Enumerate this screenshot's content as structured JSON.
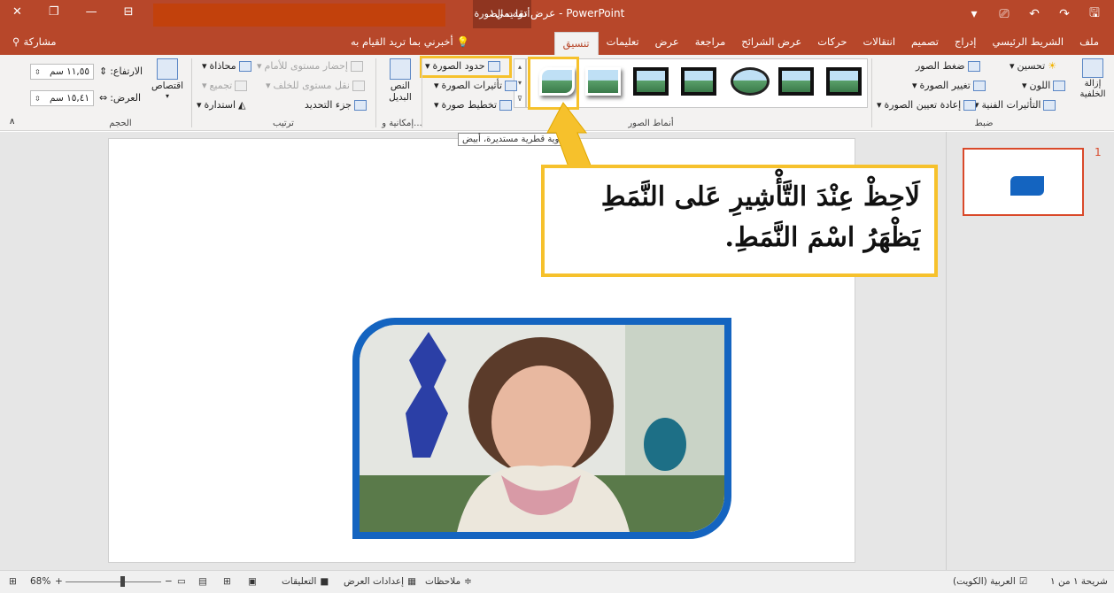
{
  "titlebar": {
    "doc_title": "عرض تقديمي١  -  PowerPoint",
    "context_label": "أدوات الصورة",
    "colors": {
      "accent": "#b7472a",
      "context": "#8f3520",
      "redaction": "#c2410c"
    }
  },
  "tabs": [
    {
      "label": "ملف"
    },
    {
      "label": "الشريط الرئيسي"
    },
    {
      "label": "إدراج"
    },
    {
      "label": "تصميم"
    },
    {
      "label": "انتقالات"
    },
    {
      "label": "حركات"
    },
    {
      "label": "عرض الشرائح"
    },
    {
      "label": "مراجعة"
    },
    {
      "label": "عرض"
    },
    {
      "label": "تعليمات"
    },
    {
      "label": "تنسيق",
      "active": true
    }
  ],
  "tellme": "أخبرني بما تريد القيام به",
  "share": "مشاركة",
  "ribbon": {
    "adjust": {
      "remove_bg": "إزالة الخلفية",
      "corrections": "تحسين",
      "color": "اللون",
      "artistic": "التأثيرات الفنية",
      "compress": "ضغط الصور",
      "change": "تغيير الصورة",
      "reset": "إعادة تعيين الصورة",
      "label": "ضبط"
    },
    "styles": {
      "label": "أنماط الصور",
      "border": "حدود الصورة",
      "effects": "تأثيرات الصورة",
      "layout": "تخطيط صورة"
    },
    "accessibility": {
      "alt_text": "النص البديل",
      "label": "إمكانية و..."
    },
    "arrange": {
      "bring_forward": "إحضار مستوى للأمام",
      "send_backward": "نقل مستوى للخلف",
      "selection_pane": "جزء التحديد",
      "align": "محاذاة",
      "group": "تجميع",
      "rotate": "استدارة",
      "label": "ترتيب"
    },
    "size": {
      "crop": "اقتصاص",
      "height_label": "الارتفاع:",
      "height_value": "١١,٥٥ سم",
      "width_label": "العرض:",
      "width_value": "١٥,٤١ سم",
      "label": "الحجم"
    }
  },
  "tooltip": "زاوية قطرية مستديرة، أبيض",
  "callout": {
    "line1": "لَاحِظْ عِنْدَ التَّأْشِيرِ عَلى النَّمَطِ",
    "line2": "يَظْهَرُ اسْمَ النَّمَطِ."
  },
  "thumbnail": {
    "number": "1"
  },
  "status": {
    "slide_info": "شريحة ١ من ١",
    "language": "العربية (الكويت)",
    "notes": "ملاحظات",
    "display_settings": "إعدادات العرض",
    "comments": "التعليقات",
    "zoom": "68%"
  }
}
